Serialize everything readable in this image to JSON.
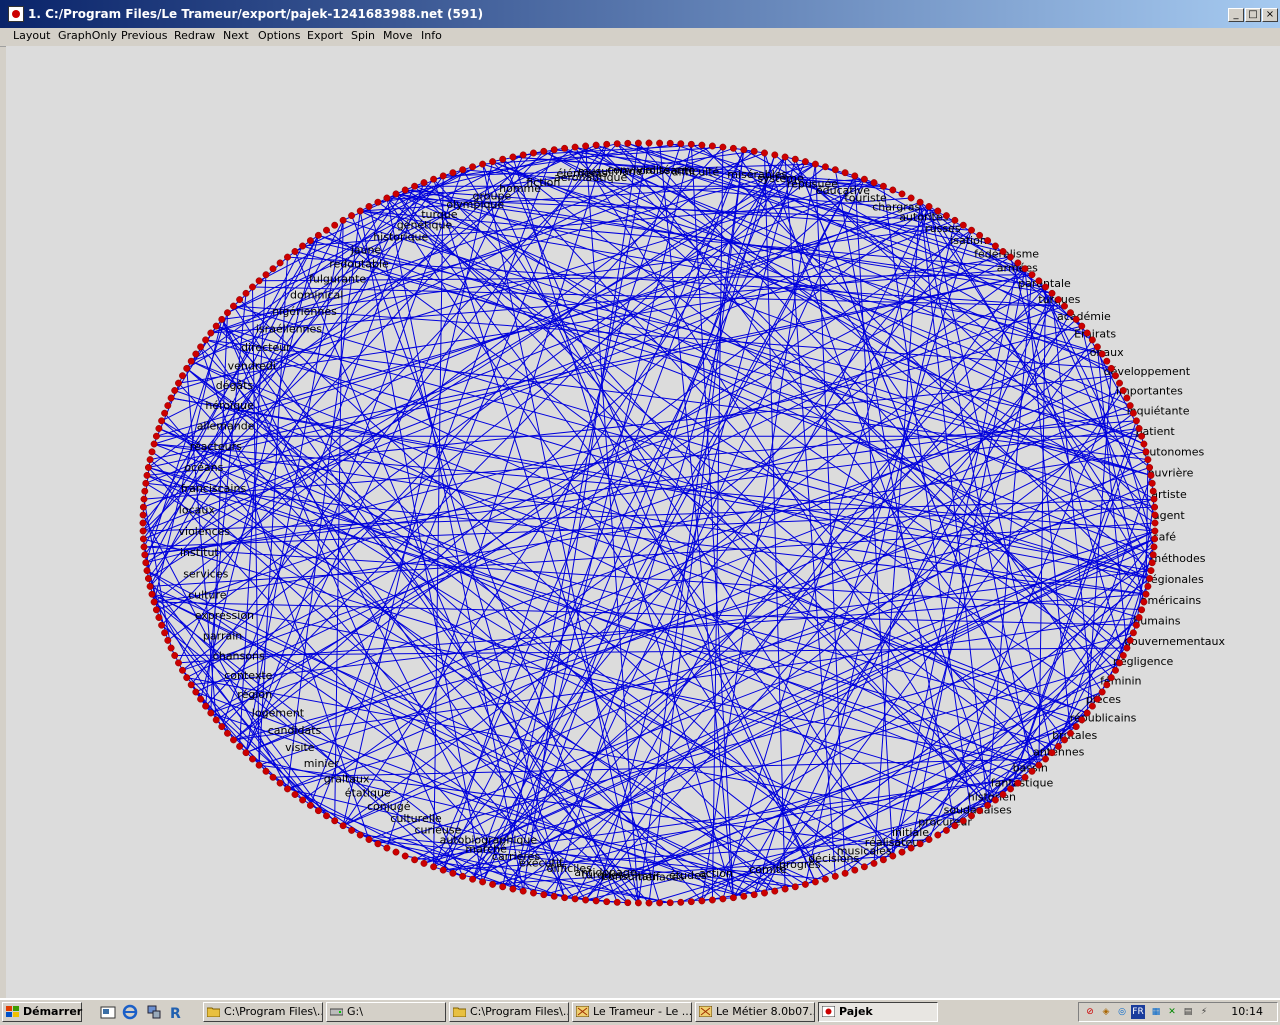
{
  "window": {
    "title": "1. C:/Program Files/Le Trameur/export/pajek-1241683988.net (591)"
  },
  "menu": [
    "Layout",
    "GraphOnly",
    "Previous",
    "Redraw",
    "Next",
    "Options",
    "Export",
    "Spin",
    "Move",
    "Info"
  ],
  "graph": {
    "node_color": "#cc0000",
    "edge_color": "#0000dd",
    "background": "#dcdcdc",
    "labels": [
      "répusuée",
      "éducative",
      "touriste",
      "chargras",
      "autorités",
      "russes",
      "isation",
      "fédéralisme",
      "armées",
      "parentale",
      "turques",
      "académie",
      "Emirats",
      "onaux",
      "développement",
      "importantes",
      "inquiétante",
      "patient",
      "autonomes",
      "ouvrière",
      "artiste",
      "agent",
      "café",
      "méthodes",
      "régionales",
      "américains",
      "humains",
      "gouvernementaux",
      "négligence",
      "féminin",
      "pièces",
      "républicains",
      "brutales",
      "antennes",
      "bassin",
      "fantastique",
      "historien",
      "soudanaises",
      "procureur",
      "initiale",
      "réalisateur",
      "musicales",
      "décisions",
      "progrès",
      "comité",
      "action",
      "études",
      "menaces",
      "consultatif",
      "turques",
      "antidopage",
      "difficiles",
      "exécutif",
      "carrières",
      "marché",
      "autobiographique",
      "curieuse",
      "culturelle",
      "conjugé",
      "étatique",
      "graltaux",
      "minier",
      "visite",
      "candidats",
      "logement",
      "région",
      "contexte",
      "chansons",
      "parrain",
      "expression",
      "culture",
      "services",
      "institut",
      "violences",
      "locaux",
      "franciscains",
      "océans",
      "réacteurs",
      "allemande",
      "héroïque",
      "dégâts",
      "vendredi",
      "directeur",
      "israéliennes",
      "nigériennes",
      "dominical",
      "fulgurante",
      "redoutable",
      "jaune",
      "historique",
      "génétique",
      "turque",
      "olympique",
      "groupe",
      "homme",
      "fiction",
      "aéronautique",
      "éléments",
      "musulmane",
      "convivialité",
      "croissante",
      "difficulté",
      "misérables",
      "système"
    ]
  },
  "taskbar": {
    "start_label": "Démarrer",
    "tasks": [
      {
        "label": "C:\\Program Files\\...",
        "icon": "folder-icon",
        "active": false
      },
      {
        "label": "G:\\",
        "icon": "drive-icon",
        "active": false
      },
      {
        "label": "C:\\Program Files\\...",
        "icon": "folder-icon",
        "active": false
      },
      {
        "label": "Le Trameur - Le ...",
        "icon": "app-icon",
        "active": false
      },
      {
        "label": "Le Métier 8.0b07...",
        "icon": "app-icon",
        "active": false
      },
      {
        "label": "Pajek",
        "icon": "pajek-icon",
        "active": true
      }
    ],
    "tray_lang": "FR",
    "clock": "10:14"
  }
}
